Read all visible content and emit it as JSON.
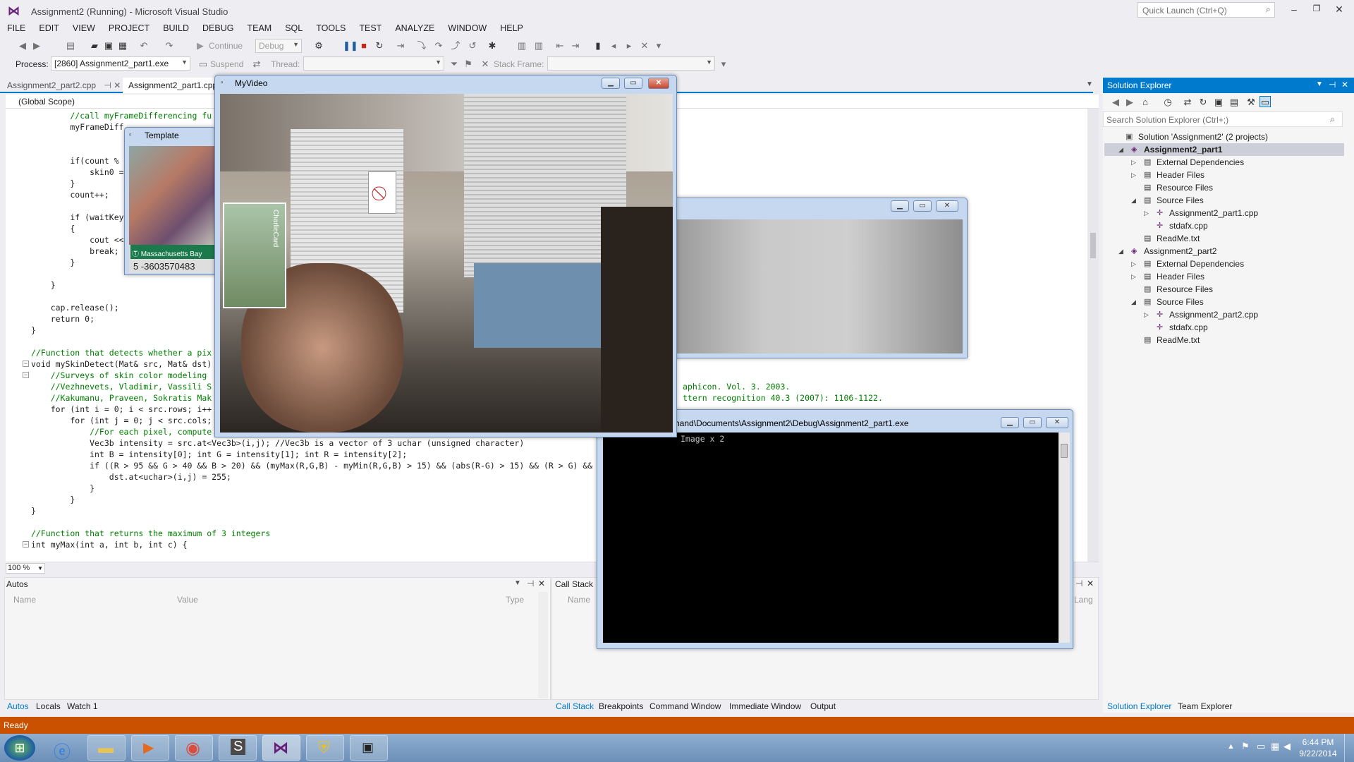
{
  "window": {
    "title": "Assignment2 (Running) - Microsoft Visual Studio",
    "quick_launch_placeholder": "Quick Launch (Ctrl+Q)"
  },
  "menu": [
    "FILE",
    "EDIT",
    "VIEW",
    "PROJECT",
    "BUILD",
    "DEBUG",
    "TEAM",
    "SQL",
    "TOOLS",
    "TEST",
    "ANALYZE",
    "WINDOW",
    "HELP"
  ],
  "toolbar": {
    "continue_label": "Continue",
    "config_value": "Debug",
    "process_label": "Process:",
    "process_value": "[2860] Assignment2_part1.exe",
    "suspend_label": "Suspend",
    "thread_label": "Thread:",
    "stack_frame_label": "Stack Frame:"
  },
  "editor": {
    "tabs": [
      {
        "label": "Assignment2_part2.cpp"
      },
      {
        "label": "Assignment2_part1.cpp"
      }
    ],
    "scope": "(Global Scope)",
    "zoom": "100 %",
    "lines": [
      {
        "text": "        //call myFrameDifferencing fu",
        "cls": "cm"
      },
      {
        "text": "        myFrameDiff",
        "cls": ""
      },
      {
        "text": "",
        "cls": ""
      },
      {
        "text": "",
        "cls": ""
      },
      {
        "text": "        if(count %",
        "cls": ""
      },
      {
        "text": "            skin0 =",
        "cls": ""
      },
      {
        "text": "        }",
        "cls": ""
      },
      {
        "text": "        count++;",
        "cls": ""
      },
      {
        "text": "",
        "cls": ""
      },
      {
        "text": "        if (waitKey",
        "cls": ""
      },
      {
        "text": "        {",
        "cls": ""
      },
      {
        "text": "            cout <<",
        "cls": ""
      },
      {
        "text": "            break;",
        "cls": ""
      },
      {
        "text": "        }",
        "cls": ""
      },
      {
        "text": "",
        "cls": ""
      },
      {
        "text": "    }",
        "cls": ""
      },
      {
        "text": "",
        "cls": ""
      },
      {
        "text": "    cap.release();",
        "cls": ""
      },
      {
        "text": "    return 0;",
        "cls": ""
      },
      {
        "text": "}",
        "cls": ""
      },
      {
        "text": "",
        "cls": ""
      },
      {
        "text": "//Function that detects whether a pix",
        "cls": "cm"
      },
      {
        "text": "void mySkinDetect(Mat& src, Mat& dst)",
        "cls": ""
      },
      {
        "text": "    //Surveys of skin color modeling",
        "cls": "cm"
      },
      {
        "text": "    //Vezhnevets, Vladimir, Vassili S",
        "cls": "cm"
      },
      {
        "text": "    //Kakumanu, Praveen, Sokratis Mak",
        "cls": "cm"
      },
      {
        "text": "    for (int i = 0; i < src.rows; i++",
        "cls": ""
      },
      {
        "text": "        for (int j = 0; j < src.cols;",
        "cls": ""
      },
      {
        "text": "            //For each pixel, compute",
        "cls": "cm"
      },
      {
        "text": "            Vec3b intensity = src.at<Vec3b>(i,j); //Vec3b is a vector of 3 uchar (unsigned character)",
        "cls": ""
      },
      {
        "text": "            int B = intensity[0]; int G = intensity[1]; int R = intensity[2];",
        "cls": ""
      },
      {
        "text": "            if ((R > 95 && G > 40 && B > 20) && (myMax(R,G,B) - myMin(R,G,B) > 15) && (abs(R-G) > 15) && (R > G) &&",
        "cls": ""
      },
      {
        "text": "                dst.at<uchar>(i,j) = 255;",
        "cls": ""
      },
      {
        "text": "            }",
        "cls": ""
      },
      {
        "text": "        }",
        "cls": ""
      },
      {
        "text": "}",
        "cls": ""
      },
      {
        "text": "",
        "cls": ""
      },
      {
        "text": "//Function that returns the maximum of 3 integers",
        "cls": "cm"
      },
      {
        "text": "int myMax(int a, int b, int c) {",
        "cls": ""
      }
    ],
    "peek_right": [
      {
        "text": "aphicon. Vol. 3. 2003."
      },
      {
        "text": "ttern recognition 40.3 (2007): 1106-1122."
      }
    ]
  },
  "autos": {
    "title": "Autos",
    "col_name": "Name",
    "col_value": "Value",
    "col_type": "Type",
    "tabs": [
      "Autos",
      "Locals",
      "Watch 1"
    ]
  },
  "callstack": {
    "title": "Call Stack",
    "col_name": "Name",
    "col_lang": "Lang",
    "tabs": [
      "Call Stack",
      "Breakpoints",
      "Command Window",
      "Immediate Window",
      "Output"
    ]
  },
  "solution_explorer": {
    "title": "Solution Explorer",
    "search_placeholder": "Search Solution Explorer (Ctrl+;)",
    "items": [
      {
        "label": "Solution 'Assignment2' (2 projects)"
      },
      {
        "label": "Assignment2_part1"
      },
      {
        "label": "External Dependencies"
      },
      {
        "label": "Header Files"
      },
      {
        "label": "Resource Files"
      },
      {
        "label": "Source Files"
      },
      {
        "label": "Assignment2_part1.cpp"
      },
      {
        "label": "stdafx.cpp"
      },
      {
        "label": "ReadMe.txt"
      },
      {
        "label": "Assignment2_part2"
      },
      {
        "label": "External Dependencies"
      },
      {
        "label": "Header Files"
      },
      {
        "label": "Resource Files"
      },
      {
        "label": "Source Files"
      },
      {
        "label": "Assignment2_part2.cpp"
      },
      {
        "label": "stdafx.cpp"
      },
      {
        "label": "ReadMe.txt"
      }
    ],
    "tabs": [
      "Solution Explorer",
      "Team Explorer"
    ]
  },
  "template_window": {
    "title": "Template",
    "card_label": "Massachusetts Bay",
    "card_number": "5 -3603570483"
  },
  "video_window": {
    "title": "MyVideo",
    "card_text": "CharlieCard"
  },
  "console_window": {
    "title": "hand\\Documents\\Assignment2\\Debug\\Assignment2_part1.exe",
    "output": "Image x 2"
  },
  "status": {
    "text": "Ready"
  },
  "clock": {
    "time": "6:44 PM",
    "date": "9/22/2014"
  },
  "colors": {
    "accent": "#007acc",
    "status_bar": "#ca5100",
    "vs_purple": "#68217a"
  }
}
